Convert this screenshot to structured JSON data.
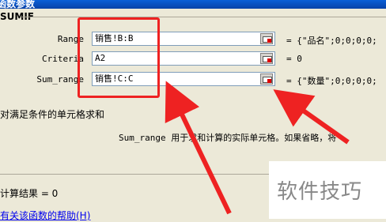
{
  "dialog": {
    "title": "函数参数",
    "group_label": "SUMIF"
  },
  "args": [
    {
      "label": "Range",
      "value": "销售!B:B",
      "result": "= {\"品名\";0;0;0;0;"
    },
    {
      "label": "Criteria",
      "value": "A2",
      "result": "= 0"
    },
    {
      "label": "Sum_range",
      "value": "销售!C:C",
      "result": "= {\"数量\";0;0;0;0;"
    }
  ],
  "total_result": "= 0",
  "description": "对满足条件的单元格求和",
  "help_text": "Sum_range  用于求和计算的实际单元格。如果省略，将",
  "calc_result": "计算结果 = 0",
  "help_link": "有关该函数的帮助(H)",
  "watermark": "软件技巧",
  "colors": {
    "highlight": "#e22222",
    "title_bar": "#0a5fd8",
    "dialog_bg": "#ece9d8"
  }
}
